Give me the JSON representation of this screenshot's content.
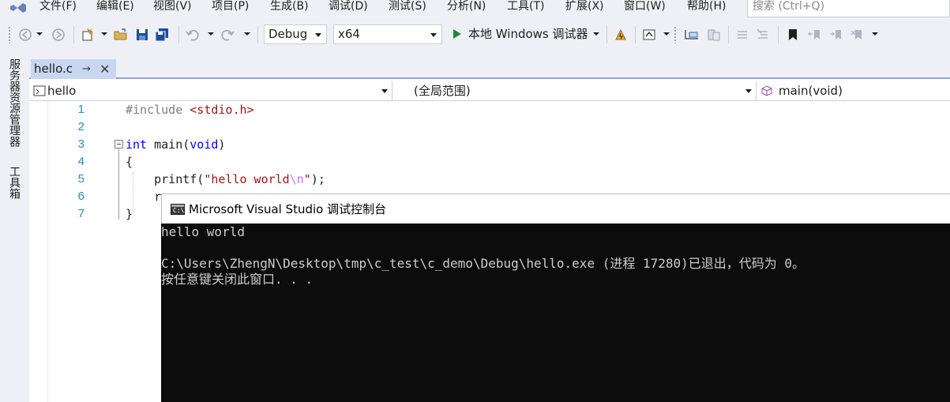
{
  "menu": {
    "items": [
      "文件(F)",
      "编辑(E)",
      "视图(V)",
      "项目(P)",
      "生成(B)",
      "调试(D)",
      "测试(S)",
      "分析(N)",
      "工具(T)",
      "扩展(X)",
      "窗口(W)",
      "帮助(H)"
    ],
    "search_placeholder": "搜索 (Ctrl+Q)"
  },
  "toolbar": {
    "config": "Debug",
    "platform": "x64",
    "run_label": "本地 Windows 调试器",
    "colors": {
      "run": "#1e8a3c",
      "save": "#1c4e9c",
      "bookmark": "#1e1e1e"
    }
  },
  "sidebar": {
    "tabs": [
      "服务器资源管理器",
      "工具箱"
    ]
  },
  "editor": {
    "tab_title": "hello.c",
    "pin_icon": "pin-icon",
    "close_icon": "close-icon",
    "nav": {
      "project": "hello",
      "scope": "(全局范围)",
      "member": "main(void)"
    },
    "line_numbers": [
      "1",
      "2",
      "3",
      "4",
      "5",
      "6",
      "7"
    ],
    "lines": [
      {
        "parts": [
          {
            "t": "#include ",
            "c": "pp"
          },
          {
            "t": "<stdio.h>",
            "c": "str"
          }
        ]
      },
      {
        "parts": []
      },
      {
        "parts": [
          {
            "t": "int",
            "c": "kw"
          },
          {
            "t": " main(",
            "c": ""
          },
          {
            "t": "void",
            "c": "kw"
          },
          {
            "t": ")",
            "c": ""
          }
        ]
      },
      {
        "parts": [
          {
            "t": "{",
            "c": ""
          }
        ]
      },
      {
        "parts": [
          {
            "t": "    printf(",
            "c": ""
          },
          {
            "t": "\"hello world",
            "c": "str"
          },
          {
            "t": "\\n",
            "c": "esc"
          },
          {
            "t": "\"",
            "c": "str"
          },
          {
            "t": ");",
            "c": ""
          }
        ]
      },
      {
        "parts": [
          {
            "t": "    r",
            "c": ""
          }
        ]
      },
      {
        "parts": [
          {
            "t": "}",
            "c": ""
          }
        ]
      }
    ]
  },
  "console": {
    "title": "Microsoft Visual Studio 调试控制台",
    "icon_text": "C:\\",
    "lines": [
      "hello world",
      "",
      "C:\\Users\\ZhengN\\Desktop\\tmp\\c_test\\c_demo\\Debug\\hello.exe (进程 17280)已退出，代码为 0。",
      "按任意键关闭此窗口. . ."
    ]
  }
}
